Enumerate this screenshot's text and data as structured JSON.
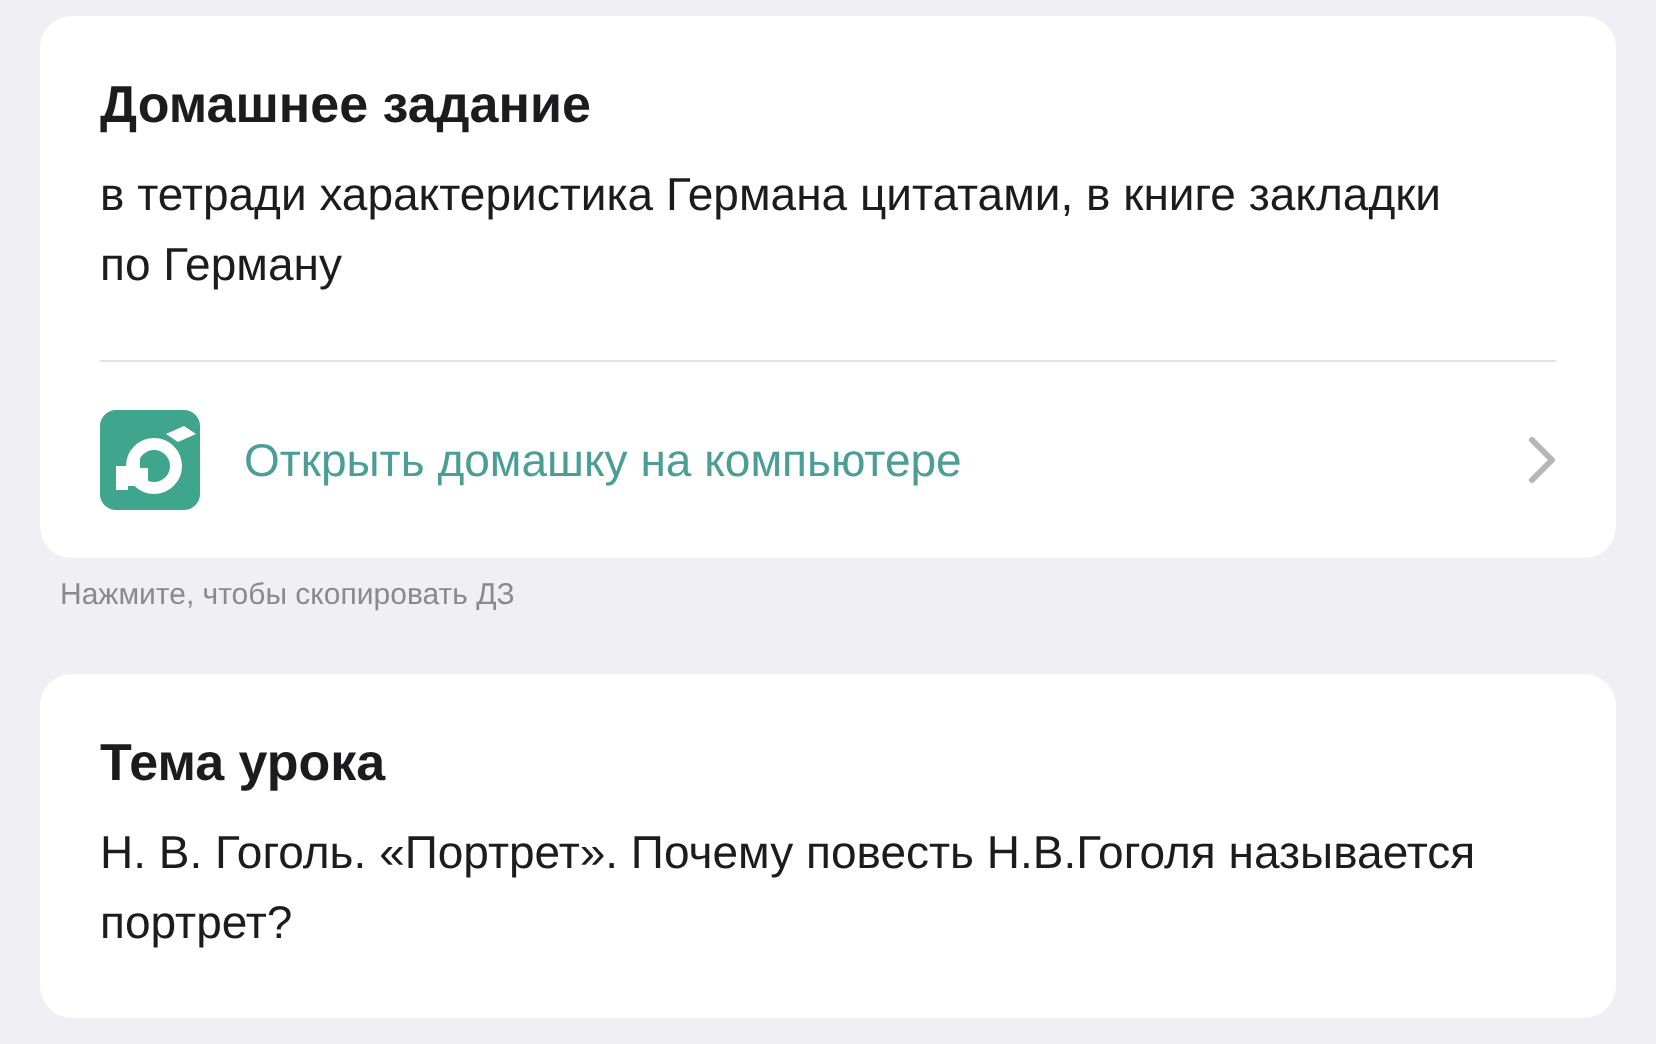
{
  "homework": {
    "title": "Домашнее задание",
    "text": "в тетради характеристика Германа цитатами, в книге закладки по Герману",
    "link": "Открыть домашку на компьютере"
  },
  "hint": "Нажмите, чтобы скопировать ДЗ",
  "lesson": {
    "title": "Тема урока",
    "text": "Н. В. Гоголь. «Портрет». Почему повесть Н.В.Гоголя называется портрет?"
  }
}
